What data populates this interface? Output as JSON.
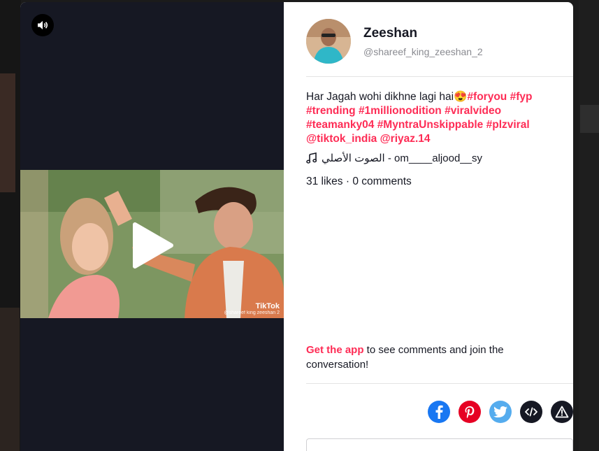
{
  "author": {
    "name": "Zeeshan",
    "handle": "@shareef_king_zeeshan_2"
  },
  "caption": {
    "text": "Har Jagah wohi dikhne lagi hai",
    "emoji": "😍",
    "tags": [
      "#foryou",
      "#fyp",
      "#trending",
      "#1millionodition",
      "#viralvideo",
      "#teamanky04",
      "#MyntraUnskippable",
      "#plzviral",
      "@tiktok_india",
      "@riyaz.14"
    ]
  },
  "music": {
    "icon": "music-note-icon",
    "title": "الصوت الأصلي - om____aljood__sy"
  },
  "stats": {
    "text": "31 likes · 0 comments"
  },
  "cta": {
    "link": "Get the app",
    "rest": " to see comments and join the conversation!"
  },
  "video": {
    "watermark_logo": "TikTok",
    "watermark_user": "@shareef king zeeshan 2"
  },
  "share_icons": [
    "facebook-icon",
    "pinterest-icon",
    "twitter-icon",
    "embed-icon",
    "report-icon"
  ],
  "colors": {
    "accent": "#fe2c55",
    "video_bg": "#161823",
    "facebook": "#1877f2",
    "pinterest": "#e60023",
    "twitter": "#55acee",
    "dark_btn": "#161823"
  }
}
